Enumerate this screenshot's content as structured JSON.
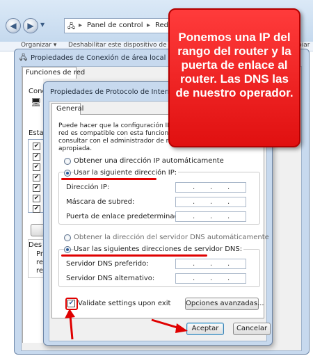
{
  "explorer": {
    "address_part1": "Panel de control",
    "address_part2": "Redes e Inter",
    "menu_organizar": "Organizar ▾",
    "menu_deshabilitar": "Deshabilitar este dispositivo de red",
    "menu_cambiar": "biar"
  },
  "back_dialog": {
    "title": "Propiedades de Conexión de área local",
    "tab_label": "Funciones de red",
    "conectar_label": "Cone",
    "esta_label": "Esta",
    "description_label": "Des",
    "description_lines": [
      "Pr",
      "re",
      "re"
    ],
    "checkbox_mark": "✔"
  },
  "tcp_dialog": {
    "title": "Propiedades de Protocolo de Internet ve",
    "tab_general": "General",
    "intro_lines": [
      "Puede hacer que la configuración IP se a",
      "red es compatible con esta funcionalidad",
      "consultar con el administrador de red cu",
      "apropiada."
    ],
    "radio_ip_auto": "Obtener una dirección IP automáticamente",
    "radio_ip_manual": "Usar la siguiente dirección IP:",
    "label_ip": "Dirección IP:",
    "label_mask": "Máscara de subred:",
    "label_gateway": "Puerta de enlace predeterminada:",
    "radio_dns_auto": "Obtener la dirección del servidor DNS automáticamente",
    "radio_dns_manual": "Usar las siguientes direcciones de servidor DNS:",
    "label_dns_pref": "Servidor DNS preferido:",
    "label_dns_alt": "Servidor DNS alternativo:",
    "validate_label": "Validate settings upon exit",
    "advanced_button": "Opciones avanzadas...",
    "accept_button": "Aceptar",
    "cancel_button": "Cancelar",
    "ip_dot": "."
  },
  "callout": {
    "text": "Ponemos una IP del rango del router y la puerta de enlace al router. Las DNS las de nuestro operador."
  },
  "colors": {
    "callout_red": "#e01010",
    "arrow_red": "#e00000",
    "dialog_border": "#6d86a7"
  }
}
